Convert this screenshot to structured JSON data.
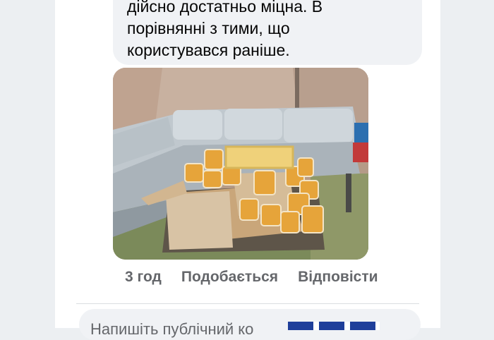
{
  "comment": {
    "text": "дійсно  достатньо міцна. В\nпорівнянні з тими, що\nкористувався раніше.",
    "photo_icon": "photo-image"
  },
  "actions": {
    "time": "3 год",
    "like": "Подобається",
    "reply": "Відповісти"
  },
  "reply_input": {
    "placeholder": "Напишіть публічний ко"
  },
  "colors": {
    "bubble": "#f0f2f5",
    "meta_text": "#65676b",
    "body_text": "#050505",
    "banner": "#1f3f9a"
  }
}
